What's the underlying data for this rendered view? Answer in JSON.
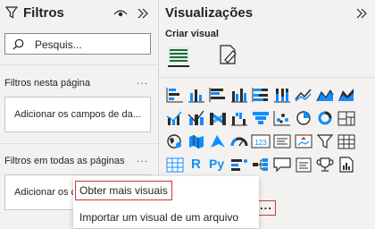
{
  "filters": {
    "title": "Filtros",
    "search_placeholder": "Pesquis...",
    "page_section": {
      "label": "Filtros nesta página",
      "more": "...",
      "drop_text": "Adicionar os campos de da..."
    },
    "all_section": {
      "label": "Filtros em todas as páginas",
      "more": "...",
      "drop_text": "Adicionar os c"
    }
  },
  "viz": {
    "title": "Visualizações",
    "create_label": "Criar visual",
    "icons": [
      "stacked-bar-icon",
      "stacked-column-icon",
      "clustered-bar-icon",
      "clustered-column-icon",
      "stacked-bar-100-icon",
      "stacked-column-100-icon",
      "line-chart-icon",
      "area-chart-icon",
      "stacked-area-icon",
      "line-clustered-column-icon",
      "line-stacked-column-icon",
      "ribbon-chart-icon",
      "waterfall-chart-icon",
      "funnel-chart-icon",
      "scatter-chart-icon",
      "pie-chart-icon",
      "donut-chart-icon",
      "treemap-icon",
      "map-icon",
      "filled-map-icon",
      "azure-map-icon",
      "gauge-icon",
      "card-icon",
      "multi-row-card-icon",
      "kpi-icon",
      "slicer-icon",
      "table-icon",
      "matrix-icon",
      "r-visual-icon",
      "python-visual-icon",
      "key-influencers-icon",
      "decomposition-tree-icon",
      "qa-icon",
      "smart-narrative-icon",
      "trophy-icon",
      "paginated-report-icon"
    ],
    "r_text": "R",
    "py_text": "Py",
    "num_text": "123",
    "more": "...",
    "colors": {
      "accent": "#118dff",
      "dark": "#2b2b2b",
      "highlight": "#d13438"
    }
  },
  "menu": {
    "items": [
      "Obter mais visuais",
      "Importar um visual de um arquivo"
    ]
  }
}
